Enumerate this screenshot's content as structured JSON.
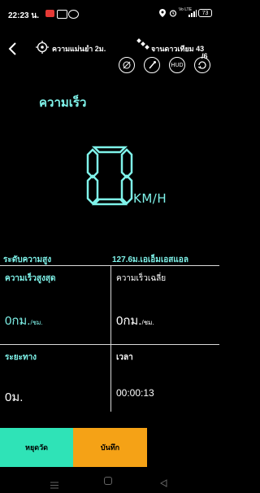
{
  "status_bar": {
    "time": "22:23 น.",
    "network_label": "Vo LTE",
    "battery": "73"
  },
  "header": {
    "back_icon": "back-arrow-icon",
    "accuracy_label": "ความแม่นยำ 2ม.",
    "satellite_label": "จานดาวเทียม 43",
    "satellite_sub": "/6"
  },
  "toolbar": {
    "items": [
      "no-speed-icon",
      "brush-icon",
      "HUD",
      "rotate-icon"
    ],
    "hud_label": "HUD"
  },
  "speed": {
    "title": "ความเร็ว",
    "value": "0",
    "unit": "KM/H"
  },
  "altitude": {
    "label": "ระดับความสูง",
    "value": "127.6ม.เอเอ็มเอสแอล"
  },
  "stats": {
    "max_speed": {
      "label": "ความเร็วสูงสุด",
      "value": "0กม.",
      "unit": "/ชม."
    },
    "avg_speed": {
      "label": "ความเร็วเฉลี่ย",
      "value": "0กม.",
      "unit": "/ชม."
    },
    "distance": {
      "label": "ระยะทาง",
      "value": "0ม."
    },
    "time": {
      "label": "เวลา",
      "value": "00:00:13"
    }
  },
  "actions": {
    "stop": "หยุดวัด",
    "save": "บันทึก"
  },
  "colors": {
    "accent": "#7ff3ea",
    "stop_button": "#2fe3b7",
    "save_button": "#f5a216"
  }
}
